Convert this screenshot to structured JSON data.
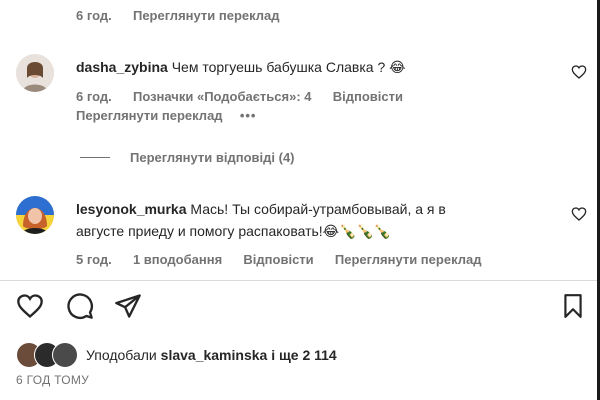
{
  "top_meta": {
    "time": "6 год.",
    "see_translation": "Переглянути переклад"
  },
  "comment1": {
    "username": "dasha_zybina",
    "text": "Чем торгуешь бабушка Славка ? 😂",
    "time": "6 год.",
    "likes": "Позначки «Подобається»: 4",
    "reply": "Відповісти",
    "see_translation": "Переглянути переклад",
    "more": "•••",
    "view_replies": "Переглянути відповіді (4)"
  },
  "comment2": {
    "username": "lesyonok_murka",
    "text_line1": "Мась! Ты собирай-утрамбовывай, а я в",
    "text_line2": "августе приеду и помогу распаковать!😂🍾🍾🍾",
    "time": "5 год.",
    "likes": "1 вподобання",
    "reply": "Відповісти",
    "see_translation": "Переглянути переклад"
  },
  "actions": {
    "icons": [
      "heart-icon",
      "comment-icon",
      "share-icon",
      "bookmark-icon"
    ]
  },
  "likes_summary": {
    "prefix": "Уподобали",
    "user": "slava_kaminska",
    "suffix": "і ще 2 114"
  },
  "post_time": "6 ГОД ТОМУ",
  "colors": {
    "text": "#262626",
    "muted": "#737373",
    "divider": "#dbdbdb"
  }
}
